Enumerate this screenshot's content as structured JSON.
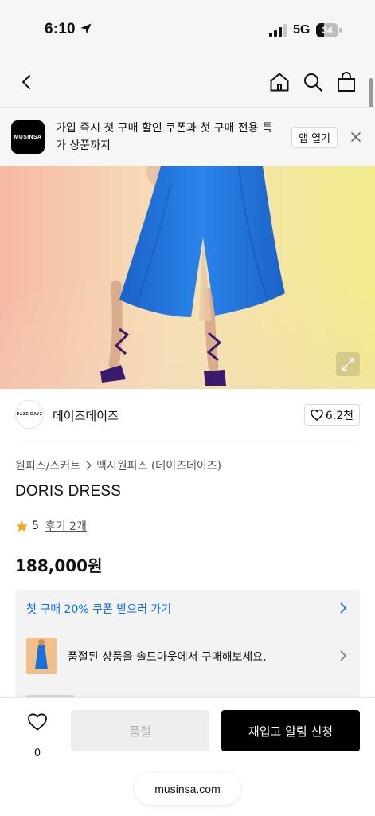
{
  "status_bar": {
    "time": "6:10",
    "network": "5G",
    "battery": "34",
    "battery_level": 0.34
  },
  "nav": {
    "icons": [
      "back-icon",
      "home-icon",
      "search-icon",
      "shopping-bag-icon"
    ]
  },
  "promo_banner": {
    "logo_text": "MUSINSA",
    "message": "가입 즉시 첫 구매 할인 쿠폰과 첫 구매 전용 특가 상품까지",
    "open_app_label": "앱 열기"
  },
  "brand": {
    "avatar_text": "DAZE DAYZ",
    "name": "데이즈데이즈",
    "likes": "6.2천"
  },
  "breadcrumb": {
    "category": "원피스/스커트",
    "subcategory": "맥시원피스 (데이즈데이즈)"
  },
  "product": {
    "name": "DORIS DRESS",
    "rating": "5",
    "reviews": "후기 2개",
    "price": "188,000원"
  },
  "benefits": {
    "coupon": "첫 구매 20% 쿠폰 받으러 가기",
    "soldout_notice": "품절된 상품을 솔드아웃에서 구매해보세요."
  },
  "bottom": {
    "wish_count": "0",
    "soldout_label": "품절",
    "restock_label": "재입고 알림 신청",
    "url": "musinsa.com"
  },
  "colors": {
    "accent_blue": "#0a6cf0",
    "dress_blue": "#1a6fd8",
    "star": "#f5a623"
  }
}
